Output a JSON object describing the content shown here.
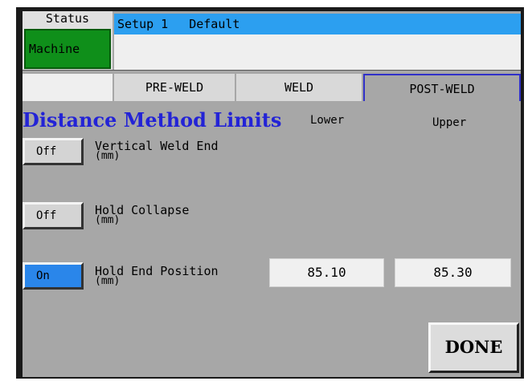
{
  "status": {
    "label": "Status",
    "machine_label": "Machine"
  },
  "title_bar": {
    "setup": "Setup 1",
    "preset": "Default"
  },
  "tabs": [
    {
      "label": "PRE-WELD",
      "active": false
    },
    {
      "label": "WELD",
      "active": false
    },
    {
      "label": "POST-WELD",
      "active": true
    }
  ],
  "section": {
    "title": "Distance Method Limits",
    "lower_label": "Lower",
    "upper_label": "Upper"
  },
  "rows": [
    {
      "toggle": "Off",
      "label": "Vertical Weld End",
      "unit": "(mm)"
    },
    {
      "toggle": "Off",
      "label": "Hold Collapse",
      "unit": "(mm)"
    },
    {
      "toggle": "On",
      "label": "Hold End Position",
      "unit": "(mm)",
      "lower": "85.10",
      "upper": "85.30"
    }
  ],
  "done_label": "DONE",
  "colors": {
    "accent_blue": "#2c9ff0",
    "machine_green": "#0f8f1a",
    "toggle_on": "#2a86ea",
    "title_text": "#2323d6"
  }
}
